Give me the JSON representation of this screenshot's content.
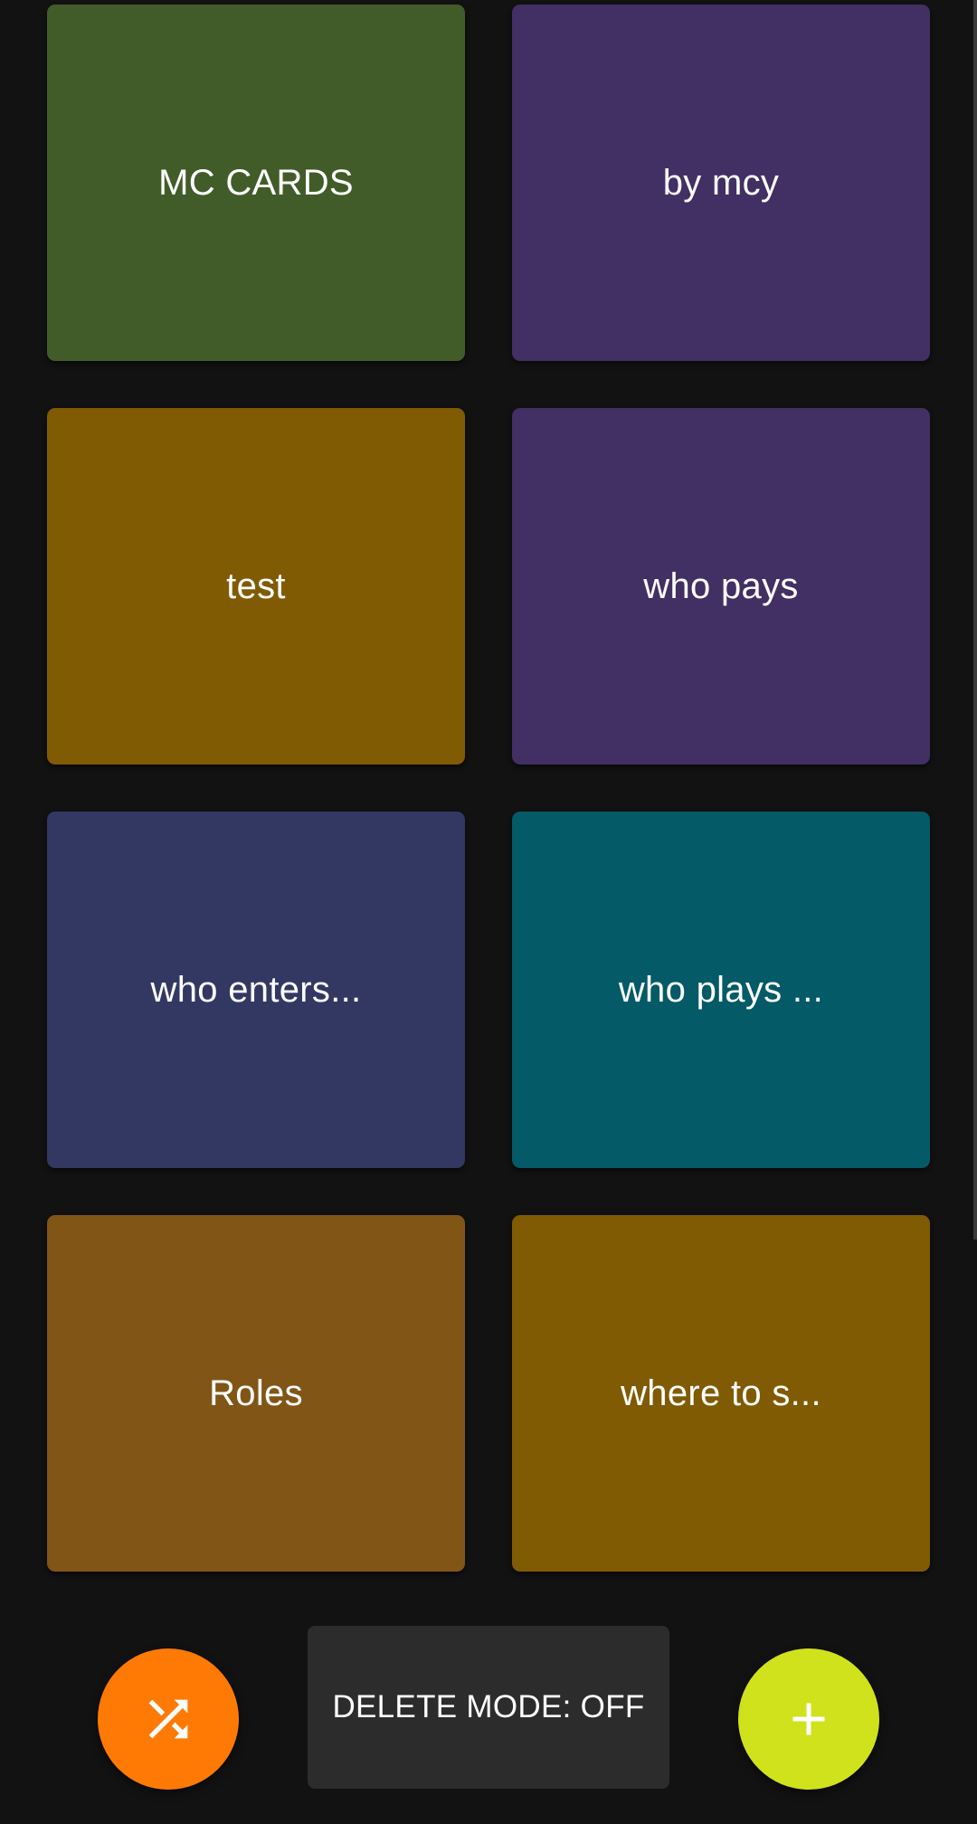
{
  "cards": [
    {
      "label": "MC CARDS",
      "color": "#425c29"
    },
    {
      "label": "by mcy",
      "color": "#422f63"
    },
    {
      "label": "test",
      "color": "#805b03"
    },
    {
      "label": "who pays",
      "color": "#422f63"
    },
    {
      "label": "who enters...",
      "color": "#333863"
    },
    {
      "label": "who plays ...",
      "color": "#045a66"
    },
    {
      "label": "Roles",
      "color": "#815516"
    },
    {
      "label": "where to s...",
      "color": "#805b03"
    }
  ],
  "controls": {
    "shuffle_color": "#ff7a05",
    "shuffle_icon": "shuffle-icon",
    "delete_mode_label": "DELETE MODE: OFF",
    "add_color": "#cfe21c",
    "add_icon": "plus-icon"
  }
}
